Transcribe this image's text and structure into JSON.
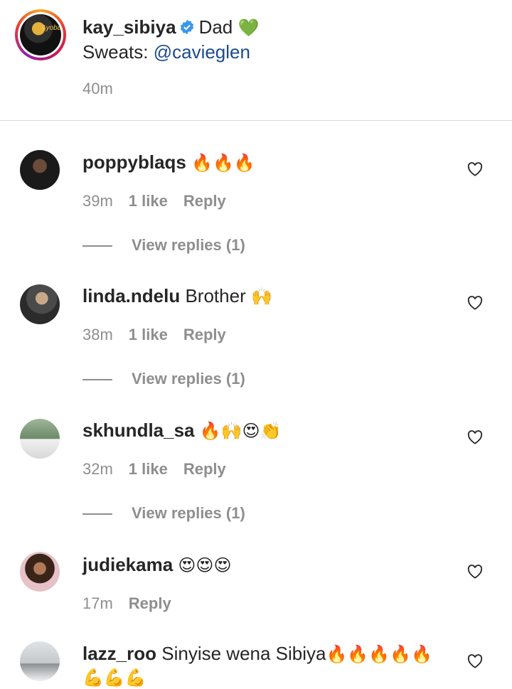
{
  "caption": {
    "username": "kay_sibiya",
    "text_line1": "Dad",
    "heart_emoji": "💚",
    "text_line2_prefix": "Sweats: ",
    "mention": "@cavieglen",
    "time": "40m"
  },
  "comments": [
    {
      "username": "poppyblaqs",
      "text": "",
      "emojis": "🔥🔥🔥",
      "time": "39m",
      "likes": "1 like",
      "reply": "Reply",
      "view_replies": "View replies (1)"
    },
    {
      "username": "linda.ndelu",
      "text": "Brother",
      "emojis": "🙌",
      "time": "38m",
      "likes": "1 like",
      "reply": "Reply",
      "view_replies": "View replies (1)"
    },
    {
      "username": "skhundla_sa",
      "text": "",
      "emojis": "🔥🙌😍👏",
      "time": "32m",
      "likes": "1 like",
      "reply": "Reply",
      "view_replies": "View replies (1)"
    },
    {
      "username": "judiekama",
      "text": "",
      "emojis": "😍😍😍",
      "time": "17m",
      "reply": "Reply"
    },
    {
      "username": "lazz_roo",
      "text": "Sinyise wena Sibiya",
      "emojis": "🔥🔥🔥🔥🔥",
      "emojis_line2": "💪💪💪"
    }
  ],
  "colors": {
    "mention": "#1b4b8f",
    "verified": "#3897f0",
    "meta": "#8e8e8e"
  },
  "icons": {
    "verified": "verified-badge-icon",
    "like": "heart-outline-icon"
  }
}
